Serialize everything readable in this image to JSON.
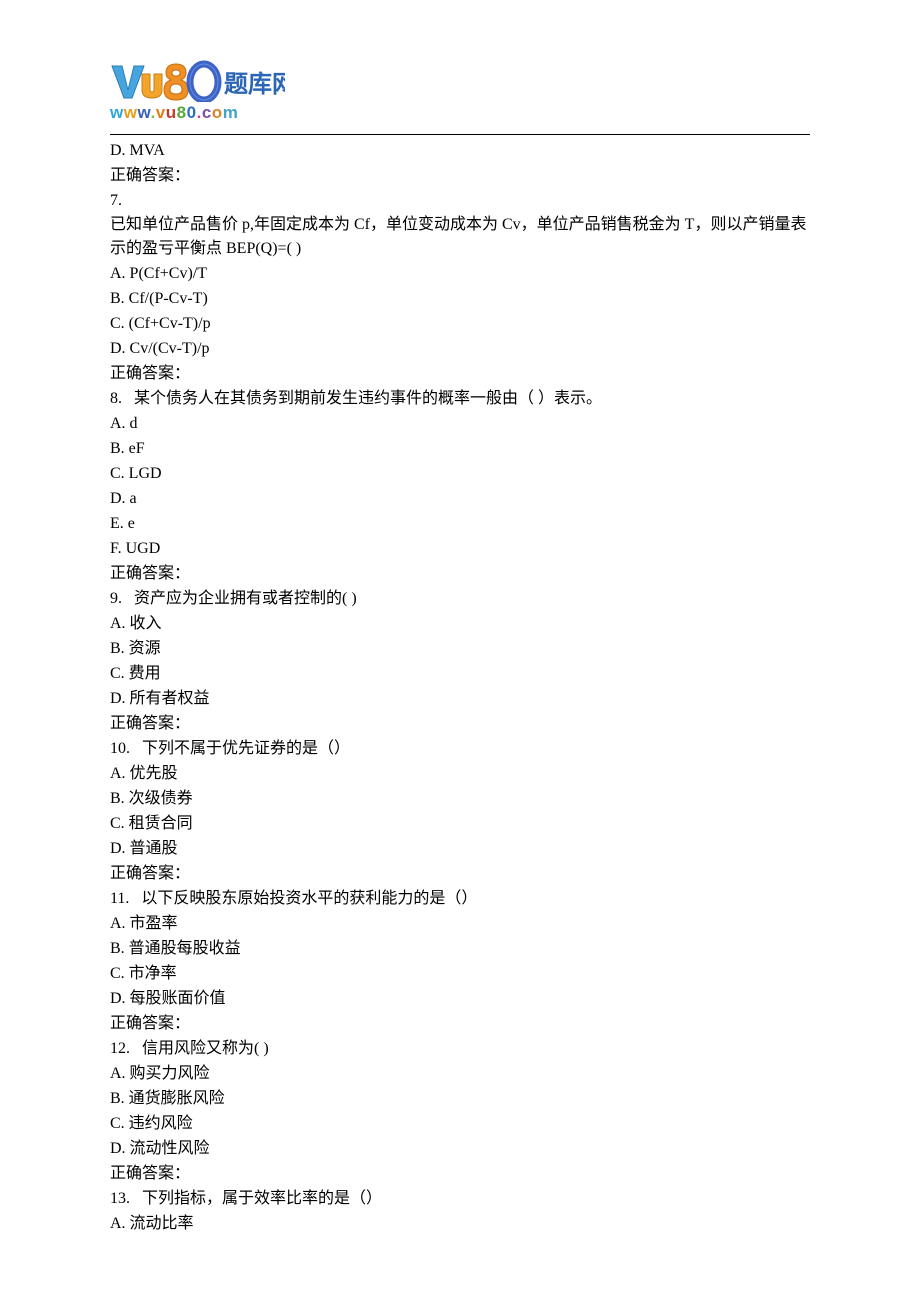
{
  "logo": {
    "url": "www.vu80.com",
    "brand_chars": "题库网"
  },
  "lines": {
    "q6d": "D. MVA",
    "q6ans": "正确答案：",
    "q7num": "7.   ",
    "q7text": "已知单位产品售价 p,年固定成本为 Cf，单位变动成本为 Cv，单位产品销售税金为 T，则以产销量表示的盈亏平衡点 BEP(Q)=( )",
    "q7a": "A. P(Cf+Cv)/T",
    "q7b": "B. Cf/(P-Cv-T)",
    "q7c": "C. (Cf+Cv-T)/p",
    "q7d": "D. Cv/(Cv-T)/p",
    "q7ans": "正确答案：",
    "q8num": "8.   ",
    "q8text": "某个债务人在其债务到期前发生违约事件的概率一般由（ ）表示。",
    "q8a": "A. d",
    "q8b": "B. eF",
    "q8c": "C. LGD",
    "q8d": "D. a",
    "q8e": "E. e",
    "q8f": "F. UGD",
    "q8ans": "正确答案：",
    "q9num": "9.   ",
    "q9text": "资产应为企业拥有或者控制的( )",
    "q9a": "A.  收入",
    "q9b": "B.  资源",
    "q9c": "C.  费用",
    "q9d": "D.  所有者权益",
    "q9ans": "正确答案：",
    "q10num": "10.   ",
    "q10text": "下列不属于优先证券的是（）",
    "q10a": "A.  优先股",
    "q10b": "B.  次级债券",
    "q10c": "C.  租赁合同",
    "q10d": "D.  普通股",
    "q10ans": "正确答案：",
    "q11num": "11.   ",
    "q11text": "以下反映股东原始投资水平的获利能力的是（）",
    "q11a": "A.  市盈率",
    "q11b": "B.  普通股每股收益",
    "q11c": "C.  市净率",
    "q11d": "D.  每股账面价值",
    "q11ans": "正确答案：",
    "q12num": "12.   ",
    "q12text": "信用风险又称为( )",
    "q12a": "A.  购买力风险",
    "q12b": "B.  通货膨胀风险",
    "q12c": "C.  违约风险",
    "q12d": "D.  流动性风险",
    "q12ans": "正确答案：",
    "q13num": "13.   ",
    "q13text": "下列指标，属于效率比率的是（）",
    "q13a": "A.  流动比率"
  }
}
